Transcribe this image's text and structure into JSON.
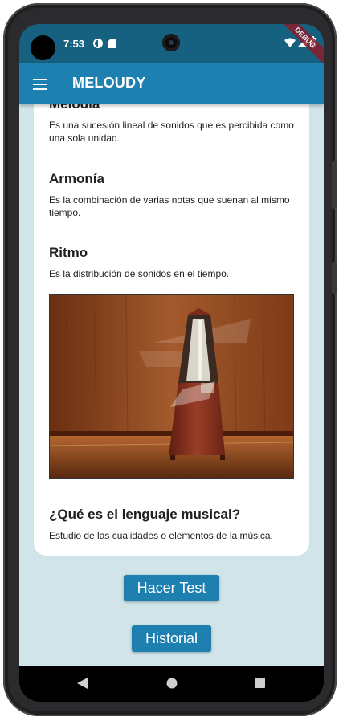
{
  "status_bar": {
    "time": "7:53",
    "badge": "DEBUG",
    "icons_left": [
      "data-saver-icon",
      "sd-card-icon"
    ],
    "icons_right": [
      "wifi-icon",
      "signal-icon",
      "battery-icon"
    ]
  },
  "app_bar": {
    "title": "MELOUDY",
    "menu_icon": "hamburger-menu-icon"
  },
  "sections": [
    {
      "title": "Melodía",
      "text": "Es una sucesión lineal de sonidos que es percibida como una sola unidad."
    },
    {
      "title": "Armonía",
      "text": "Es la combinación de varias notas que suenan al mismo tiempo."
    },
    {
      "title": "Ritmo",
      "text": "Es la distribución de sonidos en el tiempo."
    }
  ],
  "image": {
    "subject": "metronome"
  },
  "question": {
    "title": "¿Qué es el lenguaje musical?",
    "text": "Estudio de las cualidades o elementos de la música."
  },
  "buttons": {
    "test_label": "Hacer Test",
    "history_label": "Historial"
  },
  "colors": {
    "status_bar": "#15617f",
    "app_bar": "#1d80b1",
    "background": "#d0e4ea",
    "card": "#ffffff",
    "button": "#1d80b1"
  },
  "nav_bar": {
    "icons": [
      "back-icon",
      "home-icon",
      "recents-icon"
    ]
  }
}
